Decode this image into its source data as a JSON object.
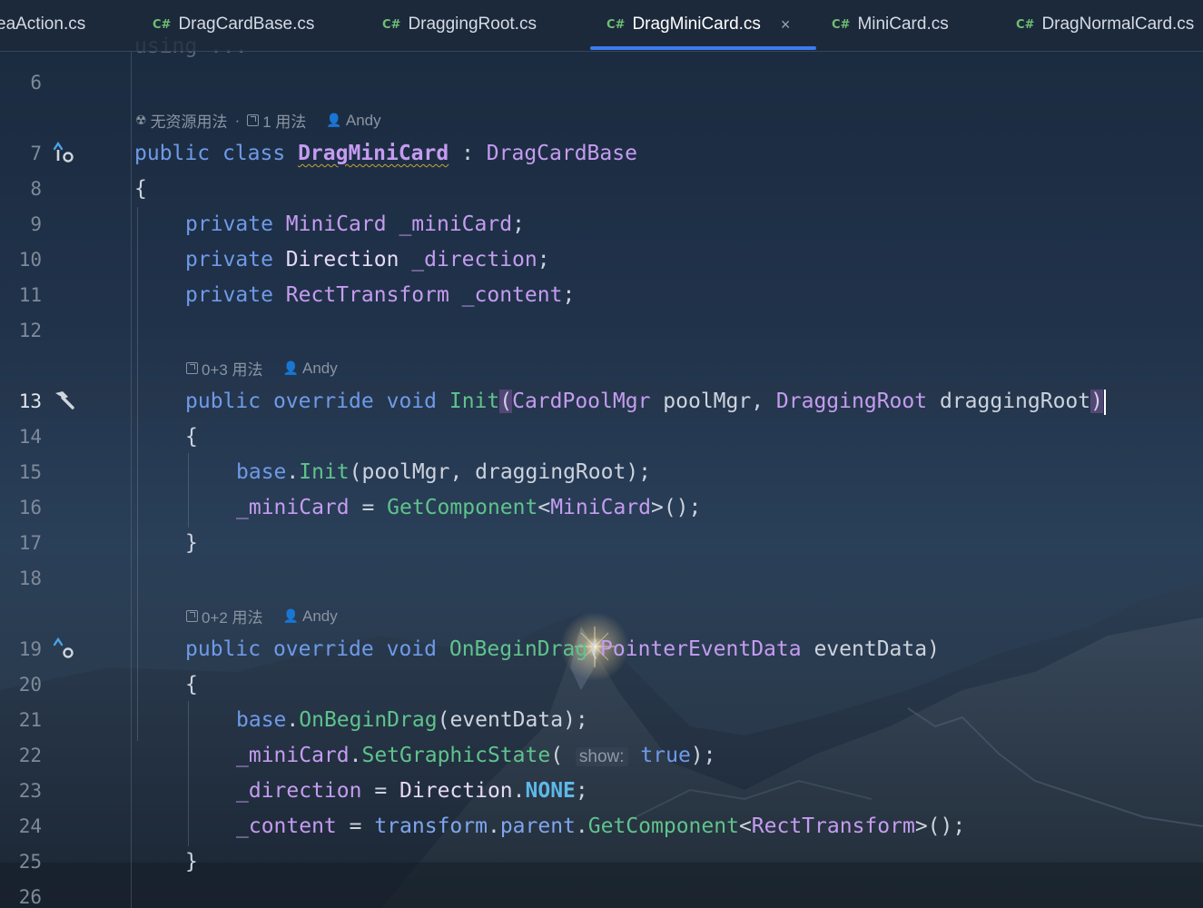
{
  "tabs": [
    {
      "name": "tab-ideaaction",
      "label": "eaAction.cs",
      "lang": "",
      "active": false
    },
    {
      "name": "tab-dragcardbase",
      "label": "DragCardBase.cs",
      "lang": "C#",
      "active": false
    },
    {
      "name": "tab-draggingroot",
      "label": "DraggingRoot.cs",
      "lang": "C#",
      "active": false
    },
    {
      "name": "tab-dragminicard",
      "label": "DragMiniCard.cs",
      "lang": "C#",
      "active": true
    },
    {
      "name": "tab-minicard",
      "label": "MiniCard.cs",
      "lang": "C#",
      "active": false
    },
    {
      "name": "tab-dragnormalcard",
      "label": "DragNormalCard.cs",
      "lang": "C#",
      "active": false
    }
  ],
  "close_glyph": "×",
  "line_numbers": [
    "6",
    "7",
    "8",
    "9",
    "10",
    "11",
    "12",
    "13",
    "14",
    "15",
    "16",
    "17",
    "18",
    "19",
    "20",
    "21",
    "22",
    "23",
    "24",
    "25",
    "26"
  ],
  "current_line": "13",
  "inlay_hints": {
    "class_hint": {
      "no_asset_usage": "无资源用法",
      "usages": "1 用法",
      "author": "Andy"
    },
    "init_hint": {
      "usages": "0+3 用法",
      "author": "Andy"
    },
    "begin_drag_hint": {
      "usages": "0+2 用法",
      "author": "Andy"
    }
  },
  "code": {
    "folded_using": "using ...",
    "param_hint_show": "show:",
    "keywords": {
      "public": "public",
      "class": "class",
      "private": "private",
      "override": "override",
      "void": "void",
      "base": "base",
      "true": "true"
    },
    "types": {
      "DragMiniCard": "DragMiniCard",
      "DragCardBase": "DragCardBase",
      "MiniCard": "MiniCard",
      "Direction": "Direction",
      "RectTransform": "RectTransform",
      "CardPoolMgr": "CardPoolMgr",
      "DraggingRoot": "DraggingRoot",
      "PointerEventData": "PointerEventData"
    },
    "fields": {
      "miniCard": "_miniCard",
      "direction": "_direction",
      "content": "_content"
    },
    "methods": {
      "Init": "Init",
      "GetComponent": "GetComponent",
      "OnBeginDrag": "OnBeginDrag",
      "SetGraphicState": "SetGraphicState"
    },
    "params": {
      "poolMgr": "poolMgr",
      "draggingRoot": "draggingRoot",
      "eventData": "eventData"
    },
    "members": {
      "transform": "transform",
      "parent": "parent",
      "NONE": "NONE"
    }
  },
  "colors": {
    "accent": "#3d7bf0",
    "keyword": "#6f9ae8",
    "type": "#c59cf0",
    "method": "#5fc38c"
  }
}
